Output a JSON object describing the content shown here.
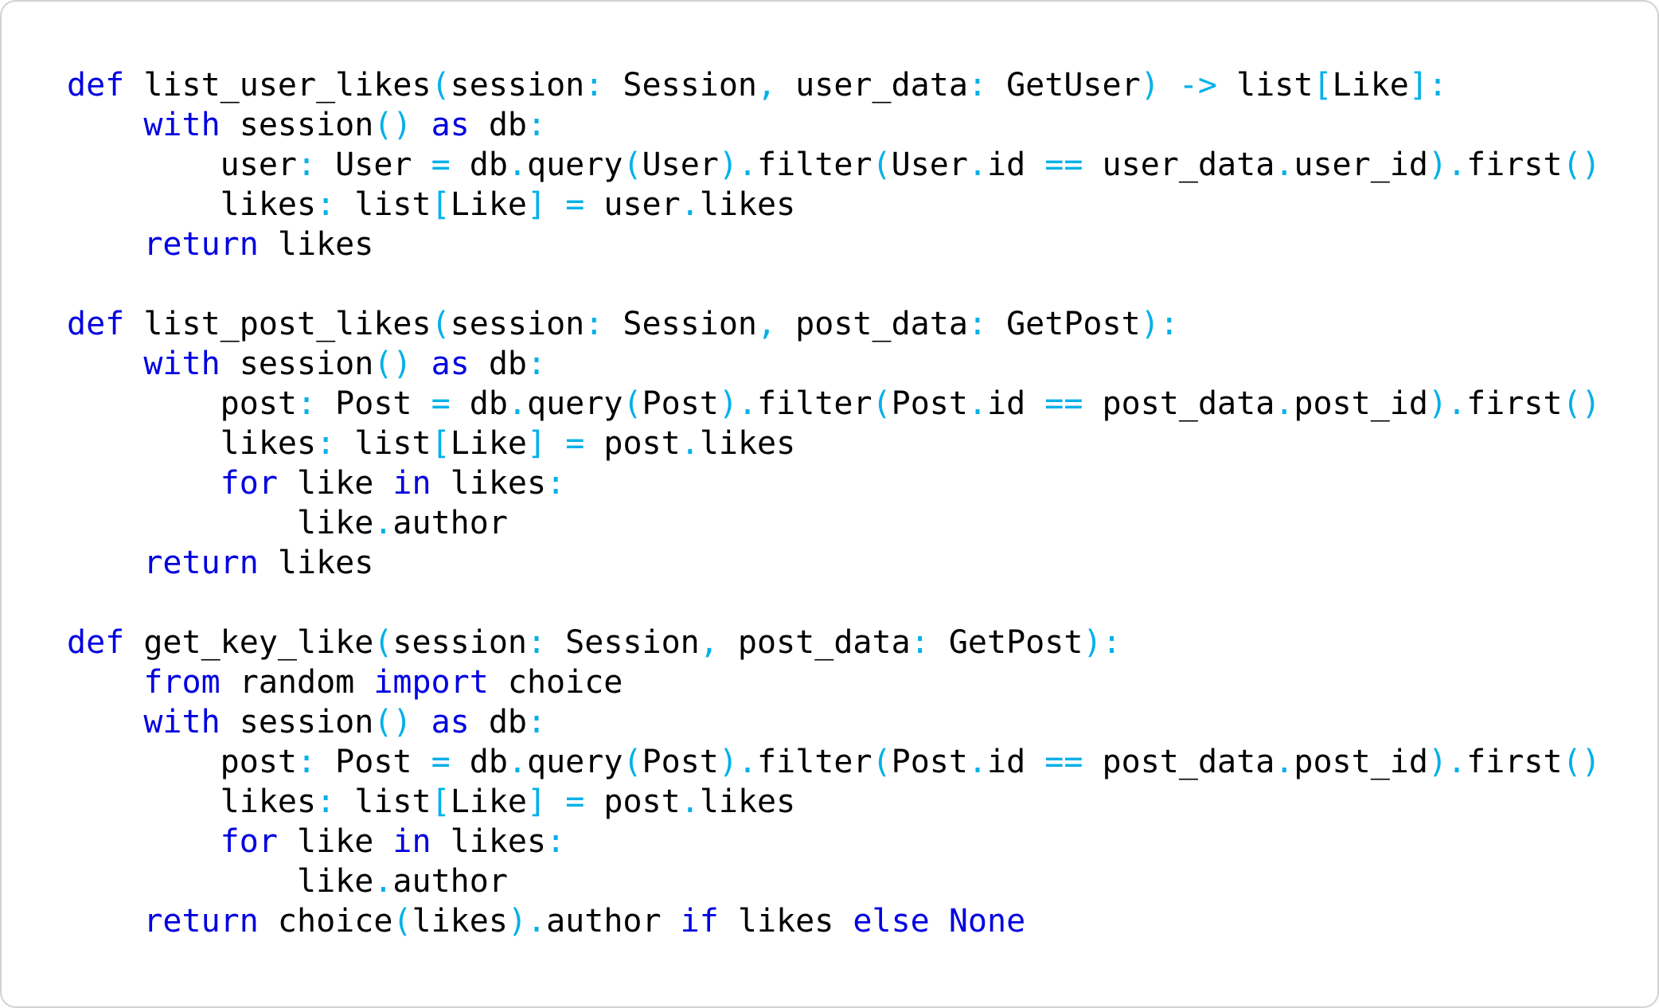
{
  "colors": {
    "background": "#ffffff",
    "border": "#d2d2d2",
    "keyword": "#0000e0",
    "operator": "#00b0e8",
    "text": "#000000"
  },
  "code_lines": [
    [
      [
        "kw",
        "def"
      ],
      [
        "id",
        " list_user_likes"
      ],
      [
        "op",
        "("
      ],
      [
        "id",
        "session"
      ],
      [
        "op",
        ":"
      ],
      [
        "id",
        " Session"
      ],
      [
        "op",
        ","
      ],
      [
        "id",
        " user_data"
      ],
      [
        "op",
        ":"
      ],
      [
        "id",
        " GetUser"
      ],
      [
        "op",
        ")"
      ],
      [
        "id",
        " "
      ],
      [
        "op",
        "->"
      ],
      [
        "id",
        " list"
      ],
      [
        "op",
        "["
      ],
      [
        "id",
        "Like"
      ],
      [
        "op",
        "]:"
      ]
    ],
    [
      [
        "id",
        "    "
      ],
      [
        "kw",
        "with"
      ],
      [
        "id",
        " session"
      ],
      [
        "op",
        "()"
      ],
      [
        "id",
        " "
      ],
      [
        "kw",
        "as"
      ],
      [
        "id",
        " db"
      ],
      [
        "op",
        ":"
      ]
    ],
    [
      [
        "id",
        "        user"
      ],
      [
        "op",
        ":"
      ],
      [
        "id",
        " User "
      ],
      [
        "op",
        "="
      ],
      [
        "id",
        " db"
      ],
      [
        "op",
        "."
      ],
      [
        "id",
        "query"
      ],
      [
        "op",
        "("
      ],
      [
        "id",
        "User"
      ],
      [
        "op",
        ")."
      ],
      [
        "id",
        "filter"
      ],
      [
        "op",
        "("
      ],
      [
        "id",
        "User"
      ],
      [
        "op",
        "."
      ],
      [
        "id",
        "id "
      ],
      [
        "op",
        "=="
      ],
      [
        "id",
        " user_data"
      ],
      [
        "op",
        "."
      ],
      [
        "id",
        "user_id"
      ],
      [
        "op",
        ")."
      ],
      [
        "id",
        "first"
      ],
      [
        "op",
        "()"
      ]
    ],
    [
      [
        "id",
        "        likes"
      ],
      [
        "op",
        ":"
      ],
      [
        "id",
        " list"
      ],
      [
        "op",
        "["
      ],
      [
        "id",
        "Like"
      ],
      [
        "op",
        "]"
      ],
      [
        "id",
        " "
      ],
      [
        "op",
        "="
      ],
      [
        "id",
        " user"
      ],
      [
        "op",
        "."
      ],
      [
        "id",
        "likes"
      ]
    ],
    [
      [
        "id",
        "    "
      ],
      [
        "kw",
        "return"
      ],
      [
        "id",
        " likes"
      ]
    ],
    [],
    [
      [
        "kw",
        "def"
      ],
      [
        "id",
        " list_post_likes"
      ],
      [
        "op",
        "("
      ],
      [
        "id",
        "session"
      ],
      [
        "op",
        ":"
      ],
      [
        "id",
        " Session"
      ],
      [
        "op",
        ","
      ],
      [
        "id",
        " post_data"
      ],
      [
        "op",
        ":"
      ],
      [
        "id",
        " GetPost"
      ],
      [
        "op",
        "):"
      ]
    ],
    [
      [
        "id",
        "    "
      ],
      [
        "kw",
        "with"
      ],
      [
        "id",
        " session"
      ],
      [
        "op",
        "()"
      ],
      [
        "id",
        " "
      ],
      [
        "kw",
        "as"
      ],
      [
        "id",
        " db"
      ],
      [
        "op",
        ":"
      ]
    ],
    [
      [
        "id",
        "        post"
      ],
      [
        "op",
        ":"
      ],
      [
        "id",
        " Post "
      ],
      [
        "op",
        "="
      ],
      [
        "id",
        " db"
      ],
      [
        "op",
        "."
      ],
      [
        "id",
        "query"
      ],
      [
        "op",
        "("
      ],
      [
        "id",
        "Post"
      ],
      [
        "op",
        ")."
      ],
      [
        "id",
        "filter"
      ],
      [
        "op",
        "("
      ],
      [
        "id",
        "Post"
      ],
      [
        "op",
        "."
      ],
      [
        "id",
        "id "
      ],
      [
        "op",
        "=="
      ],
      [
        "id",
        " post_data"
      ],
      [
        "op",
        "."
      ],
      [
        "id",
        "post_id"
      ],
      [
        "op",
        ")."
      ],
      [
        "id",
        "first"
      ],
      [
        "op",
        "()"
      ]
    ],
    [
      [
        "id",
        "        likes"
      ],
      [
        "op",
        ":"
      ],
      [
        "id",
        " list"
      ],
      [
        "op",
        "["
      ],
      [
        "id",
        "Like"
      ],
      [
        "op",
        "]"
      ],
      [
        "id",
        " "
      ],
      [
        "op",
        "="
      ],
      [
        "id",
        " post"
      ],
      [
        "op",
        "."
      ],
      [
        "id",
        "likes"
      ]
    ],
    [
      [
        "id",
        "        "
      ],
      [
        "kw",
        "for"
      ],
      [
        "id",
        " like "
      ],
      [
        "kw",
        "in"
      ],
      [
        "id",
        " likes"
      ],
      [
        "op",
        ":"
      ]
    ],
    [
      [
        "id",
        "            like"
      ],
      [
        "op",
        "."
      ],
      [
        "id",
        "author"
      ]
    ],
    [
      [
        "id",
        "    "
      ],
      [
        "kw",
        "return"
      ],
      [
        "id",
        " likes"
      ]
    ],
    [],
    [
      [
        "kw",
        "def"
      ],
      [
        "id",
        " get_key_like"
      ],
      [
        "op",
        "("
      ],
      [
        "id",
        "session"
      ],
      [
        "op",
        ":"
      ],
      [
        "id",
        " Session"
      ],
      [
        "op",
        ","
      ],
      [
        "id",
        " post_data"
      ],
      [
        "op",
        ":"
      ],
      [
        "id",
        " GetPost"
      ],
      [
        "op",
        "):"
      ]
    ],
    [
      [
        "id",
        "    "
      ],
      [
        "kw",
        "from"
      ],
      [
        "id",
        " random "
      ],
      [
        "kw",
        "import"
      ],
      [
        "id",
        " choice"
      ]
    ],
    [
      [
        "id",
        "    "
      ],
      [
        "kw",
        "with"
      ],
      [
        "id",
        " session"
      ],
      [
        "op",
        "()"
      ],
      [
        "id",
        " "
      ],
      [
        "kw",
        "as"
      ],
      [
        "id",
        " db"
      ],
      [
        "op",
        ":"
      ]
    ],
    [
      [
        "id",
        "        post"
      ],
      [
        "op",
        ":"
      ],
      [
        "id",
        " Post "
      ],
      [
        "op",
        "="
      ],
      [
        "id",
        " db"
      ],
      [
        "op",
        "."
      ],
      [
        "id",
        "query"
      ],
      [
        "op",
        "("
      ],
      [
        "id",
        "Post"
      ],
      [
        "op",
        ")."
      ],
      [
        "id",
        "filter"
      ],
      [
        "op",
        "("
      ],
      [
        "id",
        "Post"
      ],
      [
        "op",
        "."
      ],
      [
        "id",
        "id "
      ],
      [
        "op",
        "=="
      ],
      [
        "id",
        " post_data"
      ],
      [
        "op",
        "."
      ],
      [
        "id",
        "post_id"
      ],
      [
        "op",
        ")."
      ],
      [
        "id",
        "first"
      ],
      [
        "op",
        "()"
      ]
    ],
    [
      [
        "id",
        "        likes"
      ],
      [
        "op",
        ":"
      ],
      [
        "id",
        " list"
      ],
      [
        "op",
        "["
      ],
      [
        "id",
        "Like"
      ],
      [
        "op",
        "]"
      ],
      [
        "id",
        " "
      ],
      [
        "op",
        "="
      ],
      [
        "id",
        " post"
      ],
      [
        "op",
        "."
      ],
      [
        "id",
        "likes"
      ]
    ],
    [
      [
        "id",
        "        "
      ],
      [
        "kw",
        "for"
      ],
      [
        "id",
        " like "
      ],
      [
        "kw",
        "in"
      ],
      [
        "id",
        " likes"
      ],
      [
        "op",
        ":"
      ]
    ],
    [
      [
        "id",
        "            like"
      ],
      [
        "op",
        "."
      ],
      [
        "id",
        "author"
      ]
    ],
    [
      [
        "id",
        "    "
      ],
      [
        "kw",
        "return"
      ],
      [
        "id",
        " choice"
      ],
      [
        "op",
        "("
      ],
      [
        "id",
        "likes"
      ],
      [
        "op",
        ")."
      ],
      [
        "id",
        "author "
      ],
      [
        "kw",
        "if"
      ],
      [
        "id",
        " likes "
      ],
      [
        "kw",
        "else"
      ],
      [
        "id",
        " "
      ],
      [
        "kw",
        "None"
      ]
    ]
  ]
}
